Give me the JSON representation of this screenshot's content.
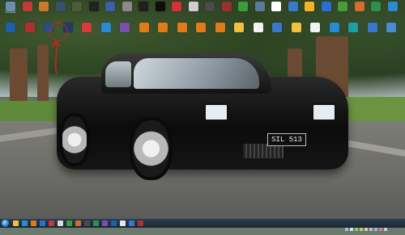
{
  "wallpaper": {
    "plate_text": "SIL 513",
    "windshield_banner": ""
  },
  "desktop_icons": [
    {
      "label": "Computer",
      "color": "#6b8fb3",
      "icon": "computer-icon"
    },
    {
      "label": "",
      "color": "#c23a3a",
      "icon": "app-icon"
    },
    {
      "label": "",
      "color": "#c97b2b",
      "icon": "app-icon"
    },
    {
      "label": "",
      "color": "#37506b",
      "icon": "game-icon"
    },
    {
      "label": "",
      "color": "#4e5a3a",
      "icon": "game-icon"
    },
    {
      "label": "",
      "color": "#222222",
      "icon": "game-icon"
    },
    {
      "label": "",
      "color": "#3d5da8",
      "icon": "app-icon"
    },
    {
      "label": "",
      "color": "#8a8a8a",
      "icon": "folder-icon"
    },
    {
      "label": "",
      "color": "#1f1f1f",
      "icon": "app-icon"
    },
    {
      "label": "",
      "color": "#0e0e0e",
      "icon": "app-icon"
    },
    {
      "label": "",
      "color": "#d6303d",
      "icon": "app-icon"
    },
    {
      "label": "",
      "color": "#cfcfcf",
      "icon": "app-icon"
    },
    {
      "label": "",
      "color": "#4a4a4a",
      "icon": "game-icon"
    },
    {
      "label": "",
      "color": "#9a2f2f",
      "icon": "app-icon"
    },
    {
      "label": "",
      "color": "#3a9e3a",
      "icon": "arrow-icon"
    },
    {
      "label": "",
      "color": "#5a7a9a",
      "icon": "app-icon"
    },
    {
      "label": "",
      "color": "#ffffff",
      "icon": "document-icon"
    },
    {
      "label": "",
      "color": "#3a78c9",
      "icon": "app-icon"
    },
    {
      "label": "",
      "color": "#f0b428",
      "icon": "app-icon"
    },
    {
      "label": "",
      "color": "#2a6fd1",
      "icon": "app-icon"
    },
    {
      "label": "",
      "color": "#4b9a3a",
      "icon": "app-icon"
    },
    {
      "label": "",
      "color": "#d0702a",
      "icon": "firefox-icon"
    },
    {
      "label": "",
      "color": "#2f8f4f",
      "icon": "app-icon"
    },
    {
      "label": "",
      "color": "#2a8bd1",
      "icon": "app-icon"
    }
  ],
  "desktop_icons_row2": [
    {
      "label": "",
      "color": "#1f5fa8",
      "icon": "app-icon"
    },
    {
      "label": "",
      "color": "#b03030",
      "icon": "app-icon"
    },
    {
      "label": "",
      "color": "#2b4e80",
      "icon": "highlighted-icon"
    },
    {
      "label": "",
      "color": "#1c3e66",
      "icon": "app-icon"
    },
    {
      "label": "",
      "color": "#d63a3a",
      "icon": "app-icon"
    },
    {
      "label": "",
      "color": "#2a8bd1",
      "icon": "app-icon"
    },
    {
      "label": "",
      "color": "#7a4fb0",
      "icon": "app-icon"
    },
    {
      "label": "",
      "color": "#e07b1a",
      "icon": "vlc-icon"
    },
    {
      "label": "",
      "color": "#e07b1a",
      "icon": "vlc-icon"
    },
    {
      "label": "",
      "color": "#e07b1a",
      "icon": "vlc-icon"
    },
    {
      "label": "",
      "color": "#e07b1a",
      "icon": "vlc-icon"
    },
    {
      "label": "",
      "color": "#e07b1a",
      "icon": "vlc-icon"
    },
    {
      "label": "",
      "color": "#f0c040",
      "icon": "folder-icon"
    },
    {
      "label": "",
      "color": "#f2f2f2",
      "icon": "document-icon"
    },
    {
      "label": "",
      "color": "#3a78c9",
      "icon": "app-icon"
    },
    {
      "label": "",
      "color": "#f0c040",
      "icon": "folder-icon"
    },
    {
      "label": "",
      "color": "#f2f2f2",
      "icon": "document-icon"
    },
    {
      "label": "",
      "color": "#2a8bd1",
      "icon": "app-icon"
    },
    {
      "label": "",
      "color": "#1fa0a0",
      "icon": "app-icon"
    },
    {
      "label": "",
      "color": "#3a78c9",
      "icon": "app-icon"
    },
    {
      "label": "",
      "color": "#4a8bd1",
      "icon": "app-icon"
    }
  ],
  "taskbar": {
    "buttons": [
      {
        "color": "#f0c040",
        "icon": "explorer-icon"
      },
      {
        "color": "#2a8bd1",
        "icon": "ie-icon"
      },
      {
        "color": "#e07b1a",
        "icon": "media-icon"
      },
      {
        "color": "#2a6fd1",
        "icon": "app-icon"
      },
      {
        "color": "#c23a3a",
        "icon": "app-icon"
      },
      {
        "color": "#d9d9d9",
        "icon": "app-icon"
      },
      {
        "color": "#3a9e3a",
        "icon": "app-icon"
      },
      {
        "color": "#d0702a",
        "icon": "firefox-icon"
      },
      {
        "color": "#4a4a4a",
        "icon": "app-icon"
      },
      {
        "color": "#2f8f4f",
        "icon": "app-icon"
      },
      {
        "color": "#7a4fb0",
        "icon": "app-icon"
      },
      {
        "color": "#1f5fa8",
        "icon": "app-icon"
      },
      {
        "color": "#e6e6e6",
        "icon": "app-icon"
      },
      {
        "color": "#3a78c9",
        "icon": "app-icon"
      },
      {
        "color": "#b03030",
        "icon": "app-icon"
      }
    ],
    "tray_colors": [
      "#9fc6e8",
      "#e0e0e0",
      "#7fd07f",
      "#e0c040",
      "#d0d0d0",
      "#c0c0c0",
      "#9fb8d8",
      "#e08080",
      "#d0d0d0"
    ],
    "clock_time": "",
    "clock_date": ""
  },
  "annotation": {
    "color": "#d12020"
  }
}
